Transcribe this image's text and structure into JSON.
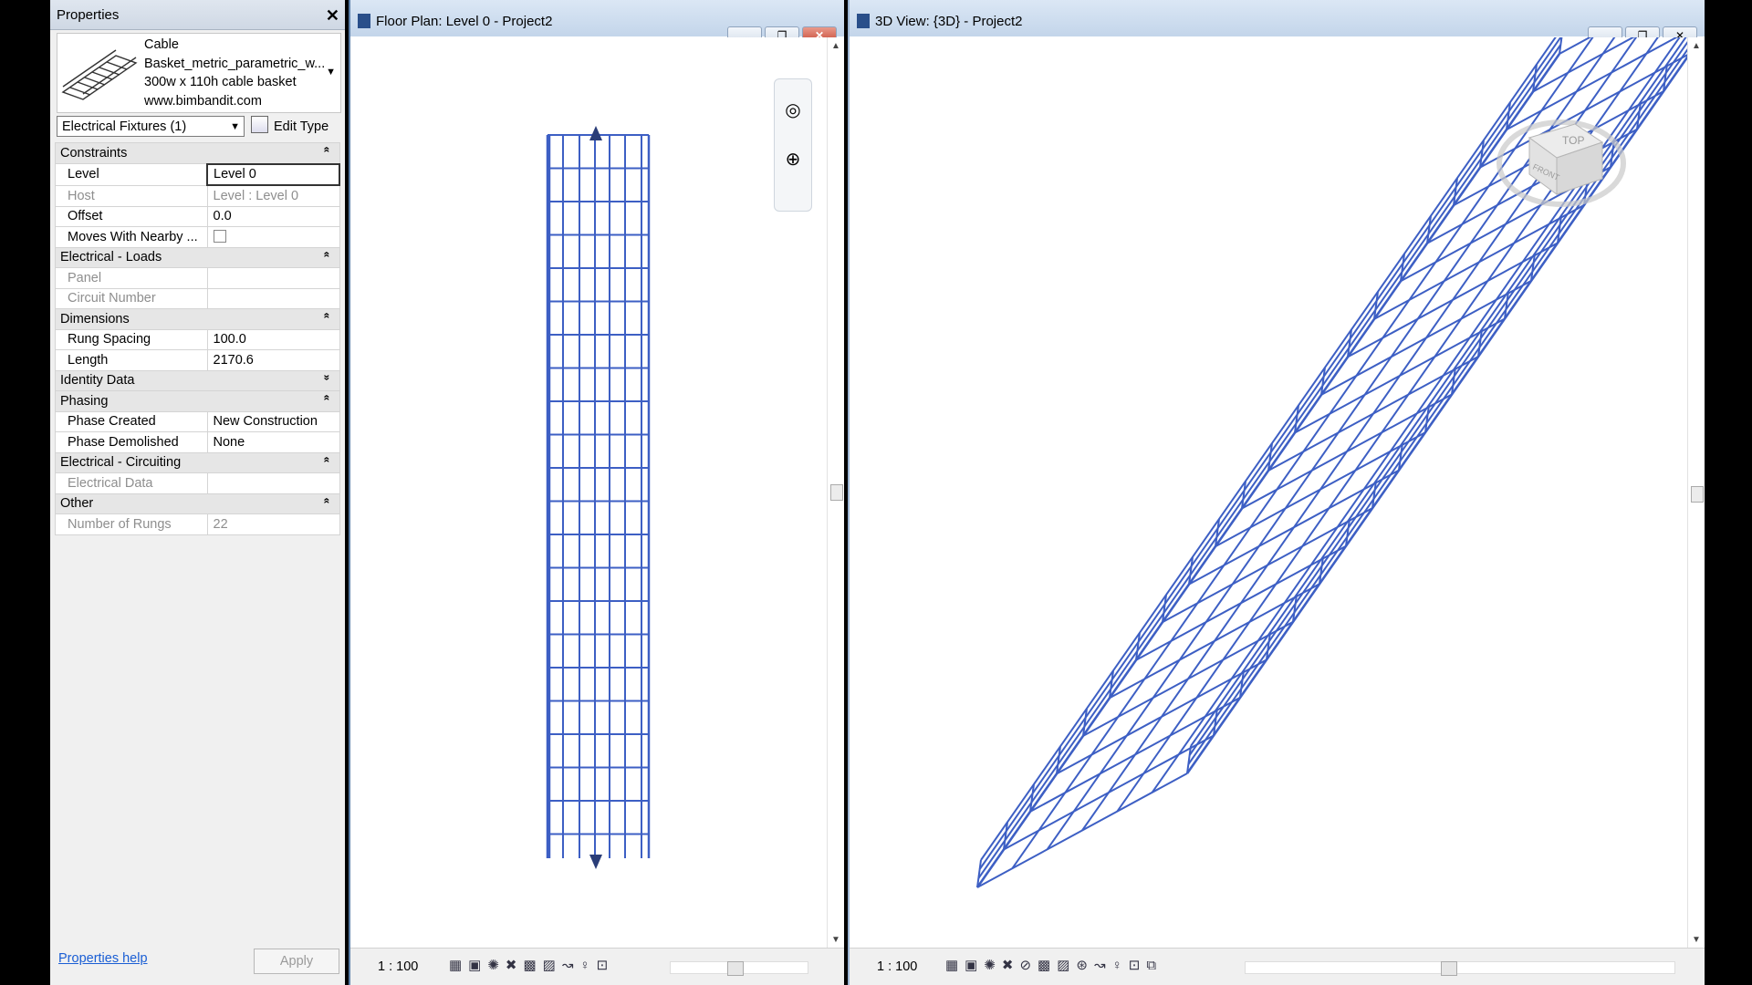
{
  "properties_panel": {
    "title": "Properties",
    "type_selector": {
      "family": "Cable",
      "type_name": "Basket_metric_parametric_w...",
      "description": "300w x 110h cable basket",
      "website": "www.bimbandit.com"
    },
    "category_filter": "Electrical Fixtures (1)",
    "edit_type_label": "Edit Type",
    "groups": [
      {
        "name": "Constraints",
        "collapsed": false,
        "params": [
          {
            "name": "Level",
            "value": "Level 0",
            "readonly": false
          },
          {
            "name": "Host",
            "value": "Level : Level 0",
            "readonly": true
          },
          {
            "name": "Offset",
            "value": "0.0",
            "readonly": false
          },
          {
            "name": "Moves With Nearby ...",
            "value": "",
            "readonly": false
          }
        ]
      },
      {
        "name": "Electrical - Loads",
        "collapsed": false,
        "params": [
          {
            "name": "Panel",
            "value": "",
            "readonly": true
          },
          {
            "name": "Circuit Number",
            "value": "",
            "readonly": true
          }
        ]
      },
      {
        "name": "Dimensions",
        "collapsed": false,
        "params": [
          {
            "name": "Rung Spacing",
            "value": "100.0",
            "readonly": false
          },
          {
            "name": "Length",
            "value": "2170.6",
            "readonly": false
          }
        ]
      },
      {
        "name": "Identity Data",
        "collapsed": true,
        "params": []
      },
      {
        "name": "Phasing",
        "collapsed": false,
        "params": [
          {
            "name": "Phase Created",
            "value": "New Construction",
            "readonly": false
          },
          {
            "name": "Phase Demolished",
            "value": "None",
            "readonly": false
          }
        ]
      },
      {
        "name": "Electrical - Circuiting",
        "collapsed": false,
        "params": [
          {
            "name": "Electrical Data",
            "value": "",
            "readonly": true
          }
        ]
      },
      {
        "name": "Other",
        "collapsed": false,
        "params": [
          {
            "name": "Number of Rungs",
            "value": "22",
            "readonly": true
          }
        ]
      }
    ],
    "help_link": "Properties help",
    "apply_label": "Apply"
  },
  "floor_plan_view": {
    "title": "Floor Plan: Level 0 - Project2",
    "scale": "1 : 100"
  },
  "view_3d": {
    "title": "3D View: {3D} - Project2",
    "scale": "1 : 100",
    "viewcube_top": "TOP",
    "viewcube_front": "FRONT"
  },
  "colors": {
    "model_line": "#3d5fc4",
    "title_bar": "#c3d5ea",
    "close_button": "#c4402c"
  }
}
